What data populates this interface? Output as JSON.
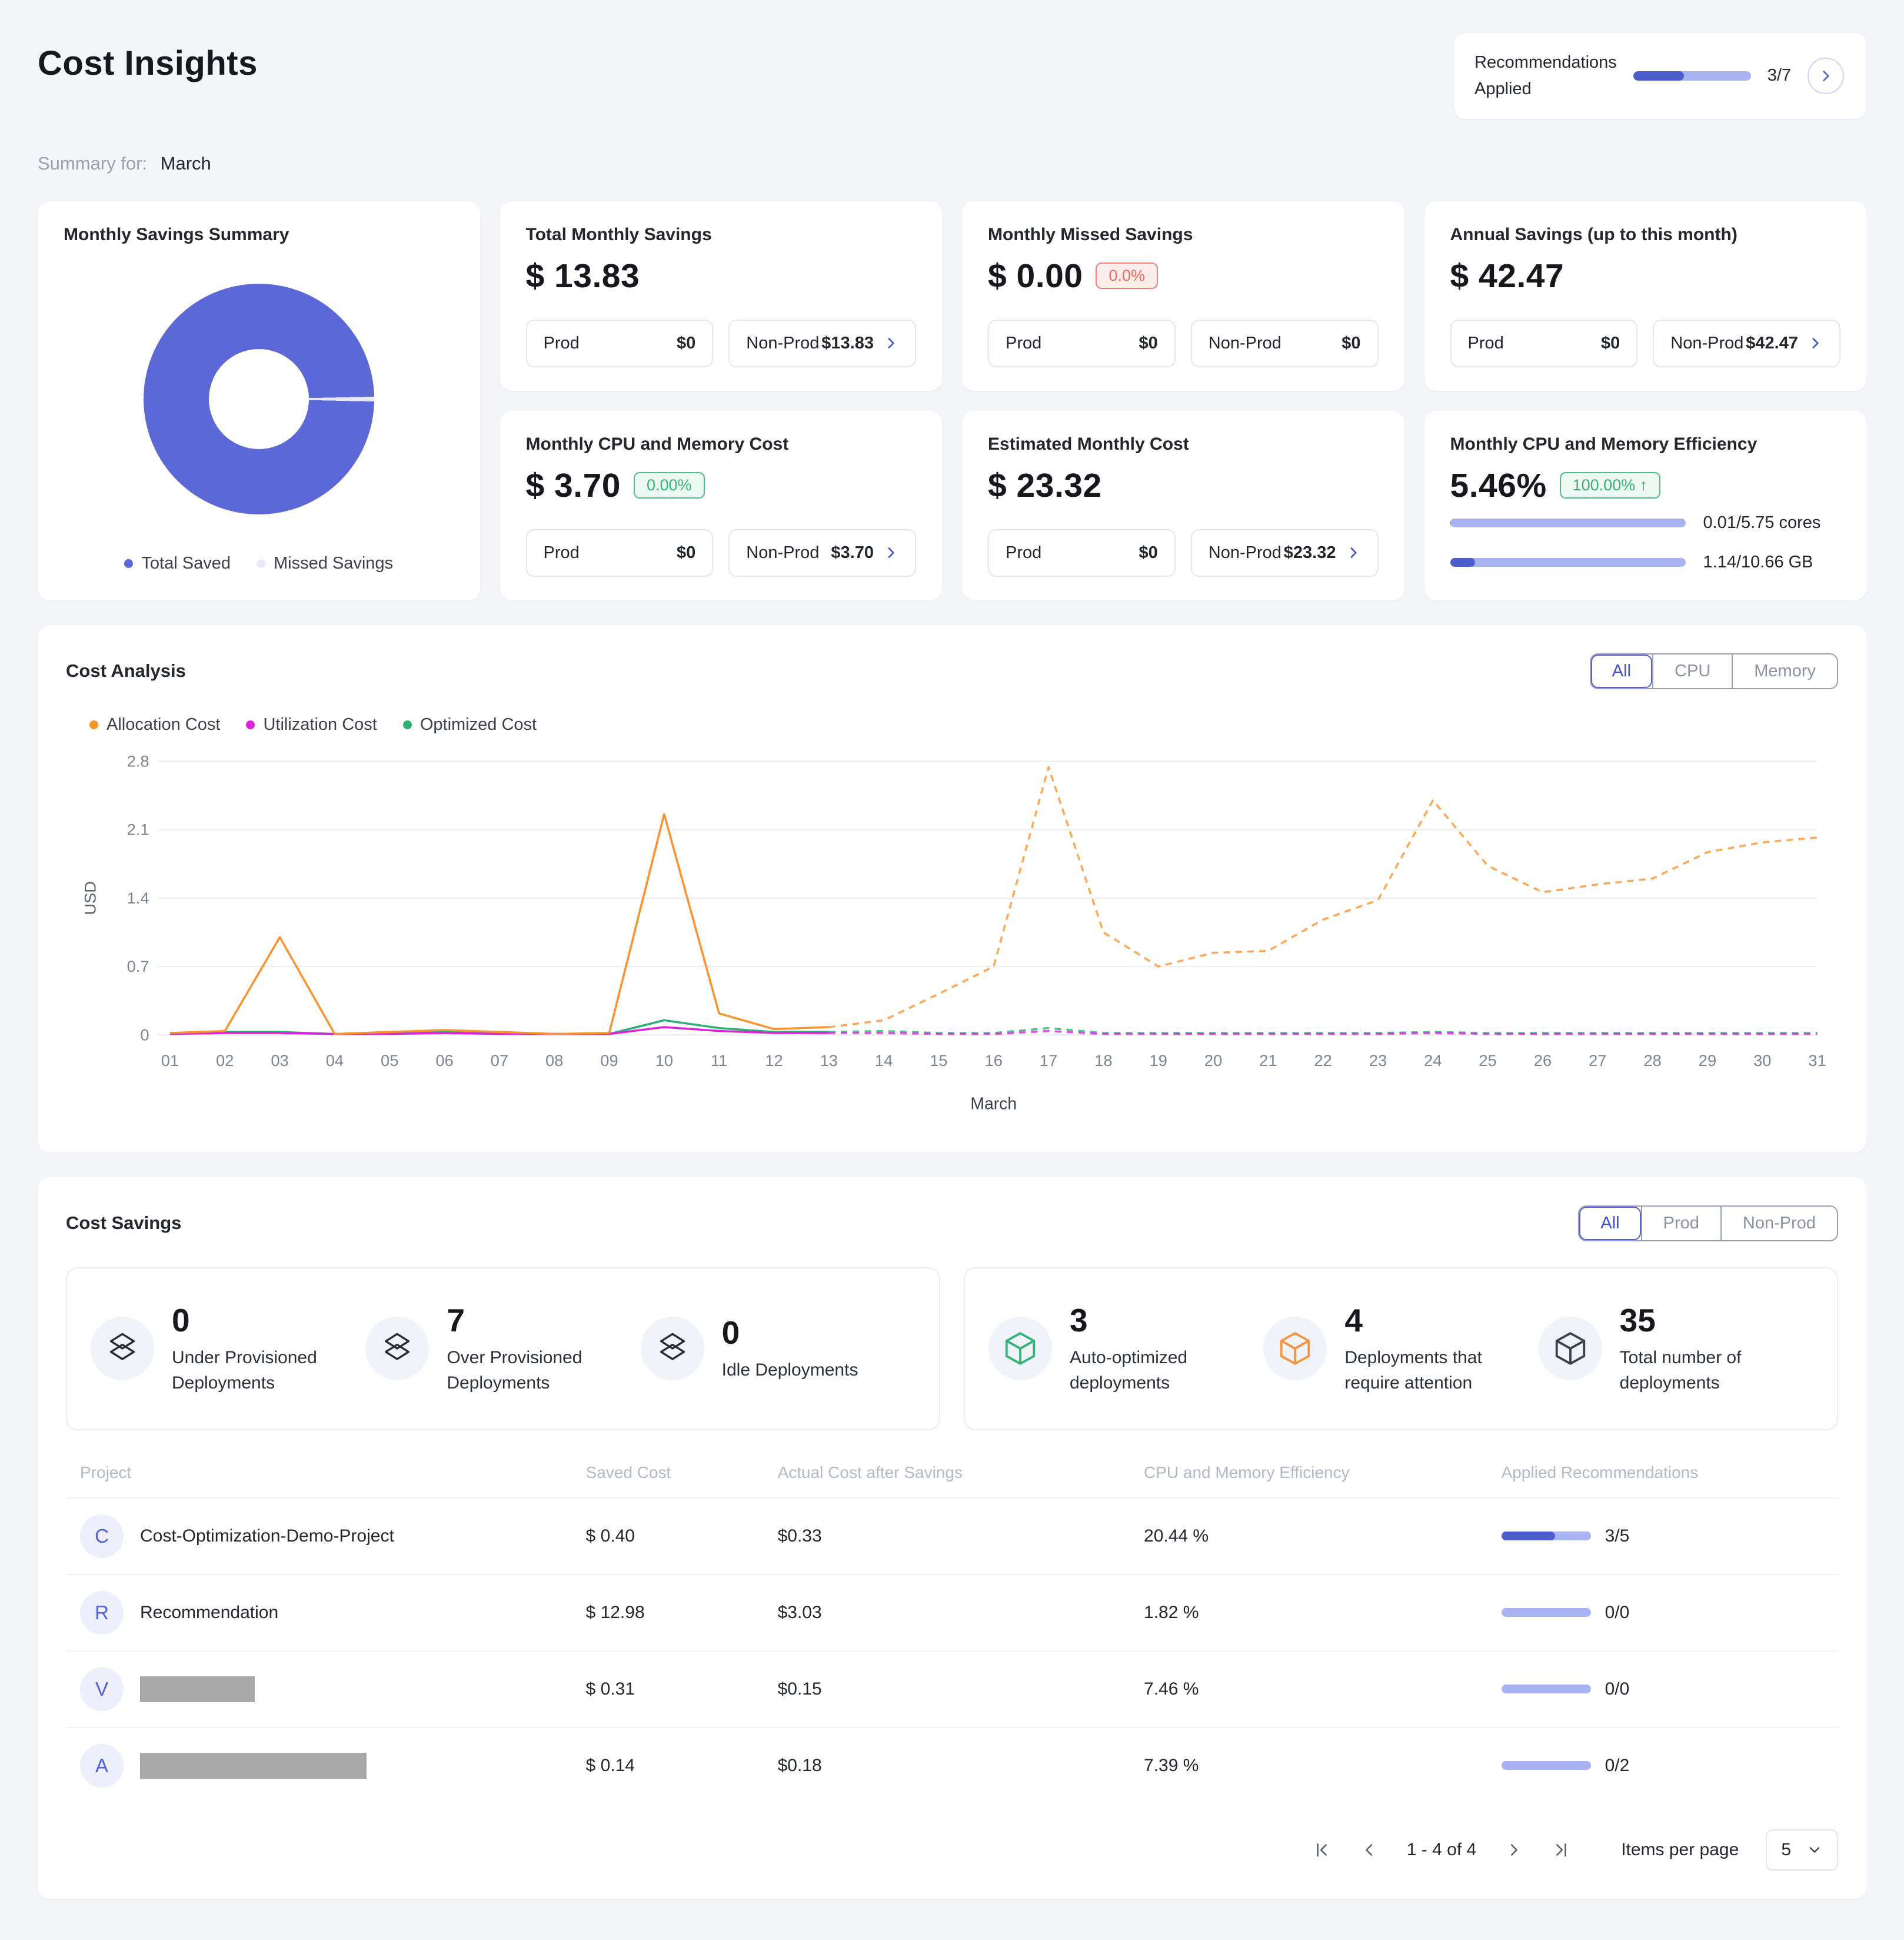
{
  "page": {
    "title": "Cost Insights",
    "summary_label": "Summary for:",
    "summary_month": "March"
  },
  "recommendations": {
    "line1": "Recommendations",
    "line2": "Applied",
    "progress_text": "3/7",
    "applied": 3,
    "total": 7
  },
  "donut_card": {
    "title": "Monthly Savings Summary",
    "legend": [
      {
        "label": "Total Saved",
        "color": "#5b68d5"
      },
      {
        "label": "Missed Savings",
        "color": "#e6e9fb"
      }
    ],
    "values": [
      13.83,
      0.0
    ]
  },
  "metric_cards": {
    "total_monthly": {
      "title": "Total Monthly Savings",
      "value": "$ 13.83",
      "prod_label": "Prod",
      "prod_value": "$0",
      "nonprod_label": "Non-Prod",
      "nonprod_value": "$13.83"
    },
    "missed": {
      "title": "Monthly Missed Savings",
      "value": "$ 0.00",
      "badge": "0.0%",
      "prod_label": "Prod",
      "prod_value": "$0",
      "nonprod_label": "Non-Prod",
      "nonprod_value": "$0"
    },
    "annual": {
      "title": "Annual Savings (up to this month)",
      "value": "$ 42.47",
      "prod_label": "Prod",
      "prod_value": "$0",
      "nonprod_label": "Non-Prod",
      "nonprod_value": "$42.47"
    },
    "cpu_mem_cost": {
      "title": "Monthly CPU and Memory Cost",
      "value": "$ 3.70",
      "badge": "0.00%",
      "prod_label": "Prod",
      "prod_value": "$0",
      "nonprod_label": "Non-Prod",
      "nonprod_value": "$3.70"
    },
    "estimated": {
      "title": "Estimated Monthly Cost",
      "value": "$ 23.32",
      "prod_label": "Prod",
      "prod_value": "$0",
      "nonprod_label": "Non-Prod",
      "nonprod_value": "$23.32"
    },
    "efficiency": {
      "title": "Monthly CPU and Memory Efficiency",
      "value": "5.46%",
      "badge": "100.00% ↑",
      "cpu_text": "0.01/5.75 cores",
      "cpu_pct": 0.3,
      "mem_text": "1.14/10.66 GB",
      "mem_pct": 10.7
    }
  },
  "cost_analysis": {
    "title": "Cost Analysis",
    "tabs": [
      "All",
      "CPU",
      "Memory"
    ],
    "active_tab": "All"
  },
  "chart_data": {
    "type": "line",
    "title": "Cost Analysis",
    "xlabel": "March",
    "ylabel": "USD",
    "x_labels": [
      "01",
      "02",
      "03",
      "04",
      "05",
      "06",
      "07",
      "08",
      "09",
      "10",
      "11",
      "12",
      "13",
      "14",
      "15",
      "16",
      "17",
      "18",
      "19",
      "20",
      "21",
      "22",
      "23",
      "24",
      "25",
      "26",
      "27",
      "28",
      "29",
      "30",
      "31"
    ],
    "ylim": [
      0,
      2.8
    ],
    "yticks": [
      0,
      0.7,
      1.4,
      2.1,
      2.8
    ],
    "grid": true,
    "legend_position": "top-left",
    "forecast_from_index": 12,
    "series": [
      {
        "name": "Allocation Cost",
        "color": "#F79330",
        "values": [
          0.02,
          0.04,
          1.0,
          0.01,
          0.03,
          0.05,
          0.03,
          0.01,
          0.02,
          2.26,
          0.22,
          0.06,
          0.08,
          0.15,
          0.42,
          0.7,
          2.74,
          1.05,
          0.7,
          0.84,
          0.86,
          1.18,
          1.38,
          2.4,
          1.73,
          1.46,
          1.54,
          1.6,
          1.87,
          1.97,
          2.02
        ]
      },
      {
        "name": "Utilization Cost",
        "color": "#DE21DE",
        "values": [
          0.01,
          0.02,
          0.02,
          0.01,
          0.01,
          0.02,
          0.01,
          0.01,
          0.01,
          0.08,
          0.04,
          0.02,
          0.02,
          0.02,
          0.01,
          0.01,
          0.04,
          0.01,
          0.01,
          0.01,
          0.01,
          0.01,
          0.01,
          0.02,
          0.01,
          0.01,
          0.01,
          0.01,
          0.01,
          0.01,
          0.01
        ]
      },
      {
        "name": "Optimized Cost",
        "color": "#2BB273",
        "values": [
          0.02,
          0.03,
          0.03,
          0.01,
          0.03,
          0.03,
          0.03,
          0.01,
          0.01,
          0.15,
          0.07,
          0.03,
          0.03,
          0.04,
          0.02,
          0.02,
          0.07,
          0.02,
          0.02,
          0.02,
          0.02,
          0.02,
          0.02,
          0.03,
          0.02,
          0.02,
          0.02,
          0.02,
          0.02,
          0.02,
          0.02
        ]
      }
    ]
  },
  "cost_savings": {
    "title": "Cost Savings",
    "tabs": [
      "All",
      "Prod",
      "Non-Prod"
    ],
    "active_tab": "All",
    "stats_left": [
      {
        "value": "0",
        "label": "Under Provisioned Deployments"
      },
      {
        "value": "7",
        "label": "Over Provisioned Deployments"
      },
      {
        "value": "0",
        "label": "Idle Deployments"
      }
    ],
    "stats_right": [
      {
        "value": "3",
        "label": "Auto-optimized deployments",
        "color": "#34b476"
      },
      {
        "value": "4",
        "label": "Deployments that require attention",
        "color": "#f79440"
      },
      {
        "value": "35",
        "label": "Total number of deployments",
        "color": "#3a4150"
      }
    ],
    "table": {
      "columns": [
        "Project",
        "Saved Cost",
        "Actual Cost after Savings",
        "CPU and Memory Efficiency",
        "Applied Recommendations"
      ],
      "rows": [
        {
          "initial": "C",
          "name": "Cost-Optimization-Demo-Project",
          "redacted": false,
          "redact_width": 0,
          "saved": "$ 0.40",
          "actual": "$0.33",
          "efficiency": "20.44 %",
          "applied": "3/5",
          "applied_pct": 60
        },
        {
          "initial": "R",
          "name": "Recommendation",
          "redacted": false,
          "redact_width": 0,
          "saved": "$ 12.98",
          "actual": "$3.03",
          "efficiency": "1.82 %",
          "applied": "0/0",
          "applied_pct": 0
        },
        {
          "initial": "V",
          "name": "",
          "redacted": true,
          "redact_width": 195,
          "saved": "$ 0.31",
          "actual": "$0.15",
          "efficiency": "7.46 %",
          "applied": "0/0",
          "applied_pct": 0
        },
        {
          "initial": "A",
          "name": "",
          "redacted": true,
          "redact_width": 385,
          "saved": "$ 0.14",
          "actual": "$0.18",
          "efficiency": "7.39 %",
          "applied": "0/2",
          "applied_pct": 0
        }
      ]
    },
    "pagination": {
      "range": "1 - 4 of 4",
      "items_per_page_label": "Items per page",
      "items_per_page": "5"
    }
  }
}
